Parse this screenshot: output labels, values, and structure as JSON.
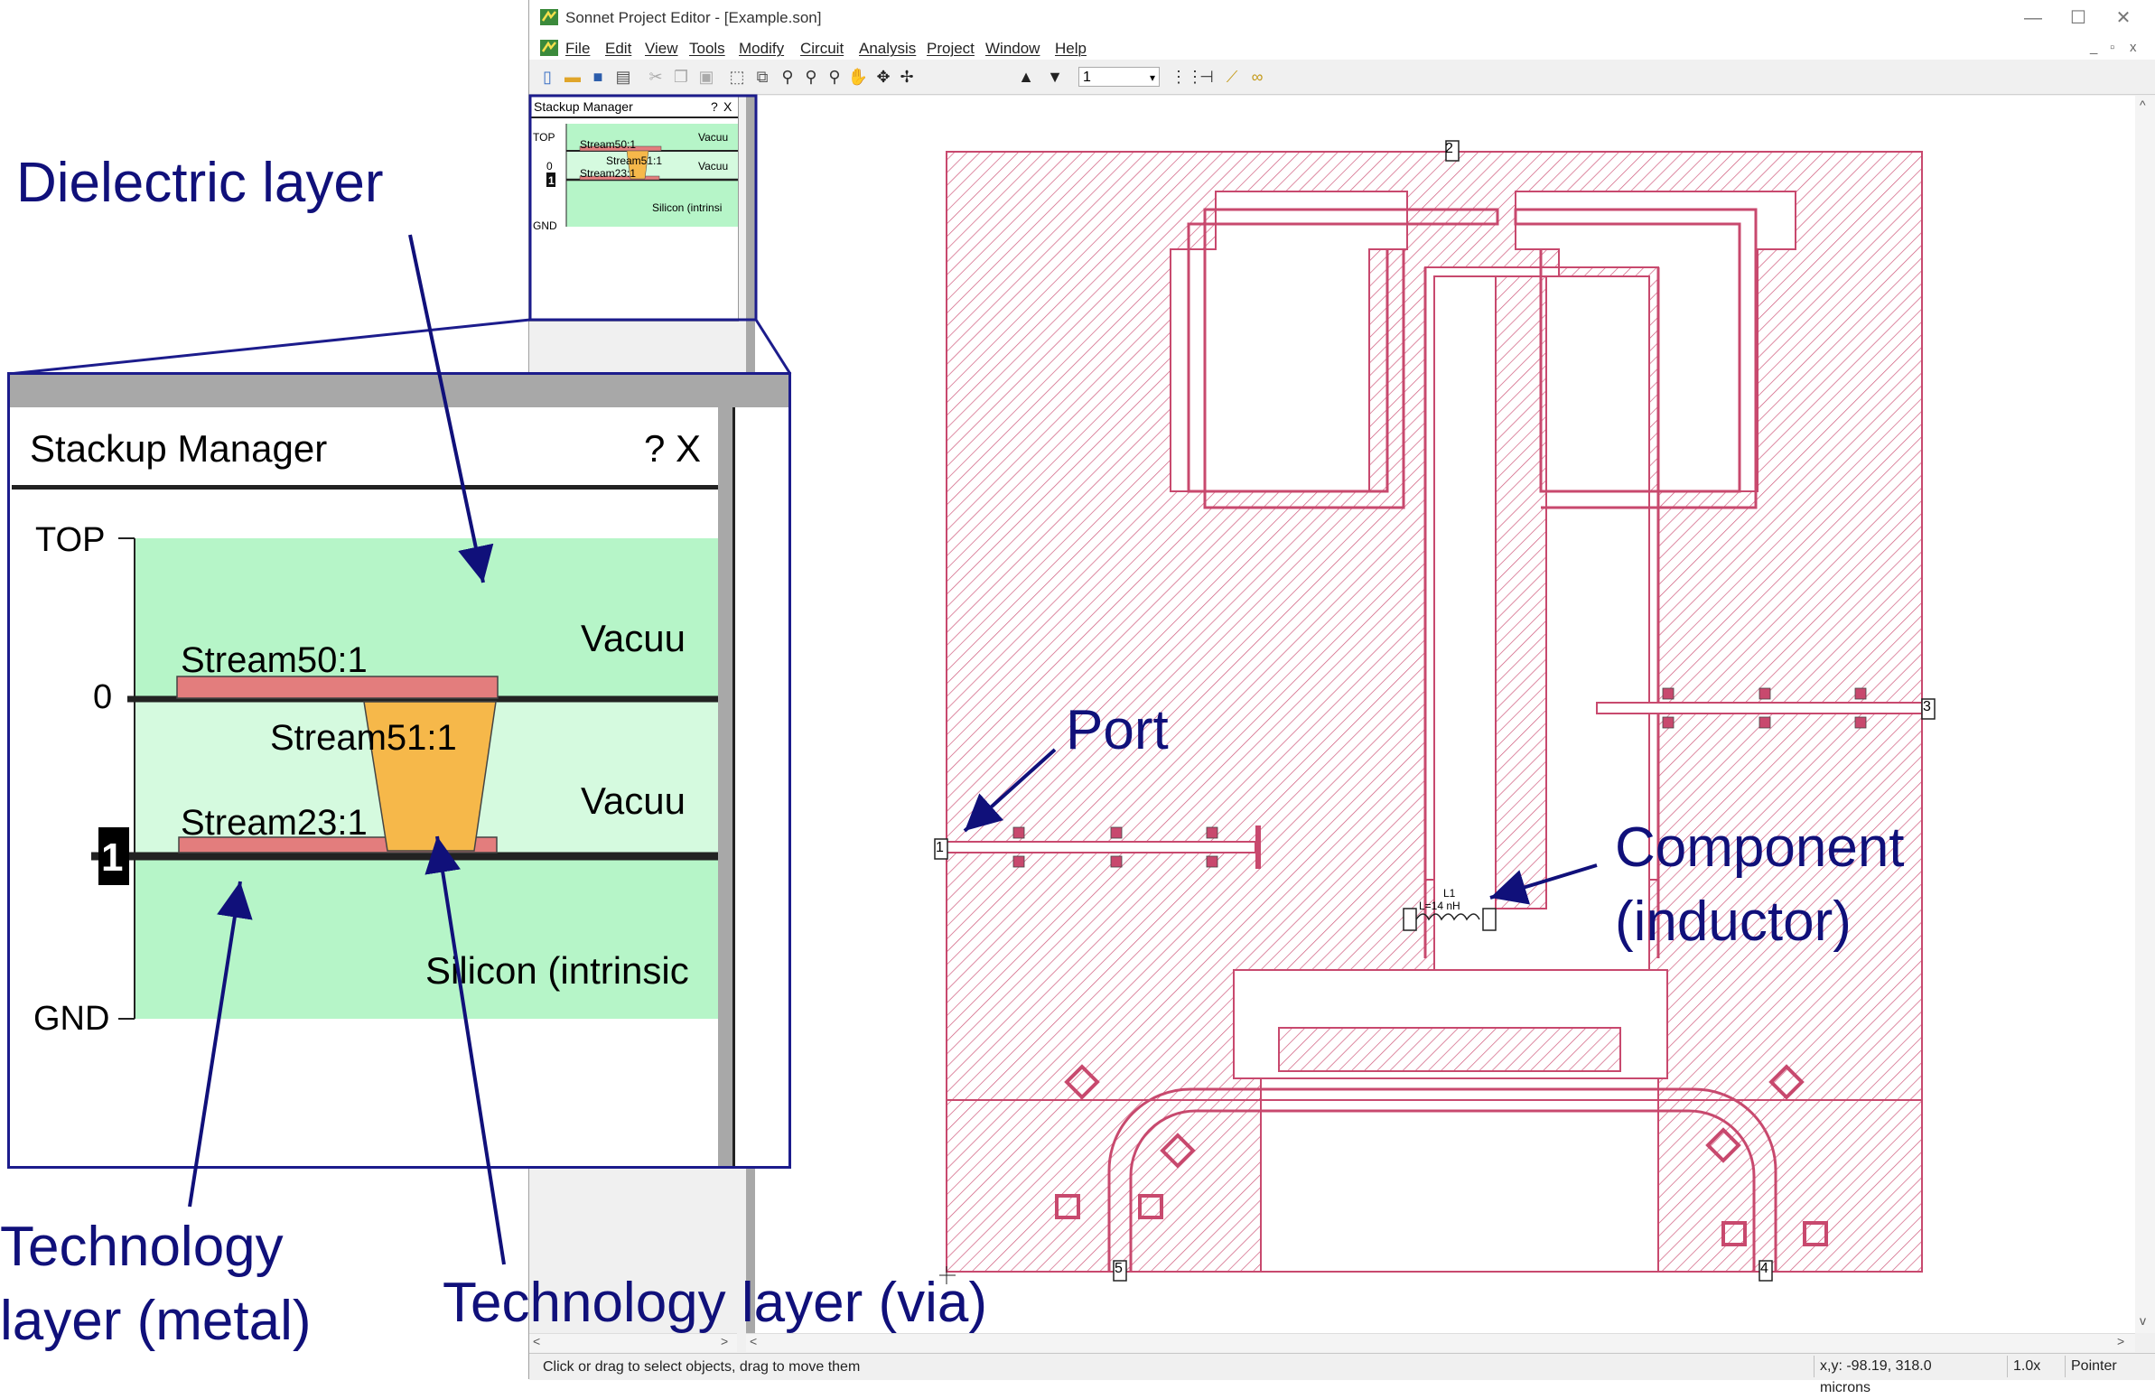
{
  "window": {
    "title": "Sonnet Project Editor - [Example.son]",
    "controls": {
      "minimize": "—",
      "maximize": "☐",
      "close": "✕"
    },
    "doc_controls": {
      "minimize": "_",
      "restore": "▫",
      "close": "x"
    }
  },
  "menu": [
    "File",
    "Edit",
    "View",
    "Tools",
    "Modify",
    "Circuit",
    "Analysis",
    "Project",
    "Window",
    "Help"
  ],
  "toolbar": {
    "layer_value": "1"
  },
  "stackup_small": {
    "title": "Stackup Manager",
    "help": "?",
    "close": "X",
    "top": "TOP",
    "zero": "0",
    "one": "1",
    "gnd": "GND",
    "metal_top": "Stream50:1",
    "via": "Stream51:1",
    "metal_bottom": "Stream23:1",
    "dielectric_1": "Vacuu",
    "dielectric_2": "Vacuu",
    "substrate": "Silicon (intrinsi"
  },
  "stackup_zoom": {
    "title": "Stackup Manager",
    "help_close": "? X",
    "top": "TOP",
    "zero": "0",
    "one": "1",
    "gnd": "GND",
    "metal_top": "Stream50:1",
    "via": "Stream51:1",
    "metal_bottom": "Stream23:1",
    "dielectric_1": "Vacuu",
    "dielectric_2": "Vacuu",
    "substrate": "Silicon (intrinsic"
  },
  "ports": [
    "1",
    "2",
    "3",
    "4",
    "5"
  ],
  "component": {
    "name": "L1",
    "value": "L=14 nH"
  },
  "annotations": {
    "dielectric": "Dielectric layer",
    "port": "Port",
    "component_line1": "Component",
    "component_line2": "(inductor)",
    "metal_line1": "Technology",
    "metal_line2": "layer (metal)",
    "via": "Technology layer (via)"
  },
  "status": {
    "hint": "Click or drag to select objects, drag to move them",
    "coords": "x,y: -98.19, 318.0 microns",
    "zoom": "1.0x",
    "mode": "Pointer"
  },
  "colors": {
    "metal": "#c8496e",
    "via": "#f6b84a",
    "dielectric": "#b6f5c8",
    "annotation": "#10107a"
  }
}
